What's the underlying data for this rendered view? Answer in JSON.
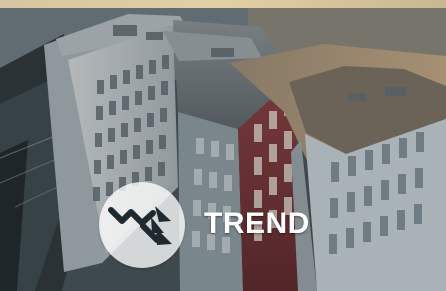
{
  "label": "TREND",
  "icon": "trend-down-icon",
  "colors": {
    "accent_dark": "#1f2930",
    "label": "#ffffff",
    "badge_bg": "#ffffff"
  }
}
